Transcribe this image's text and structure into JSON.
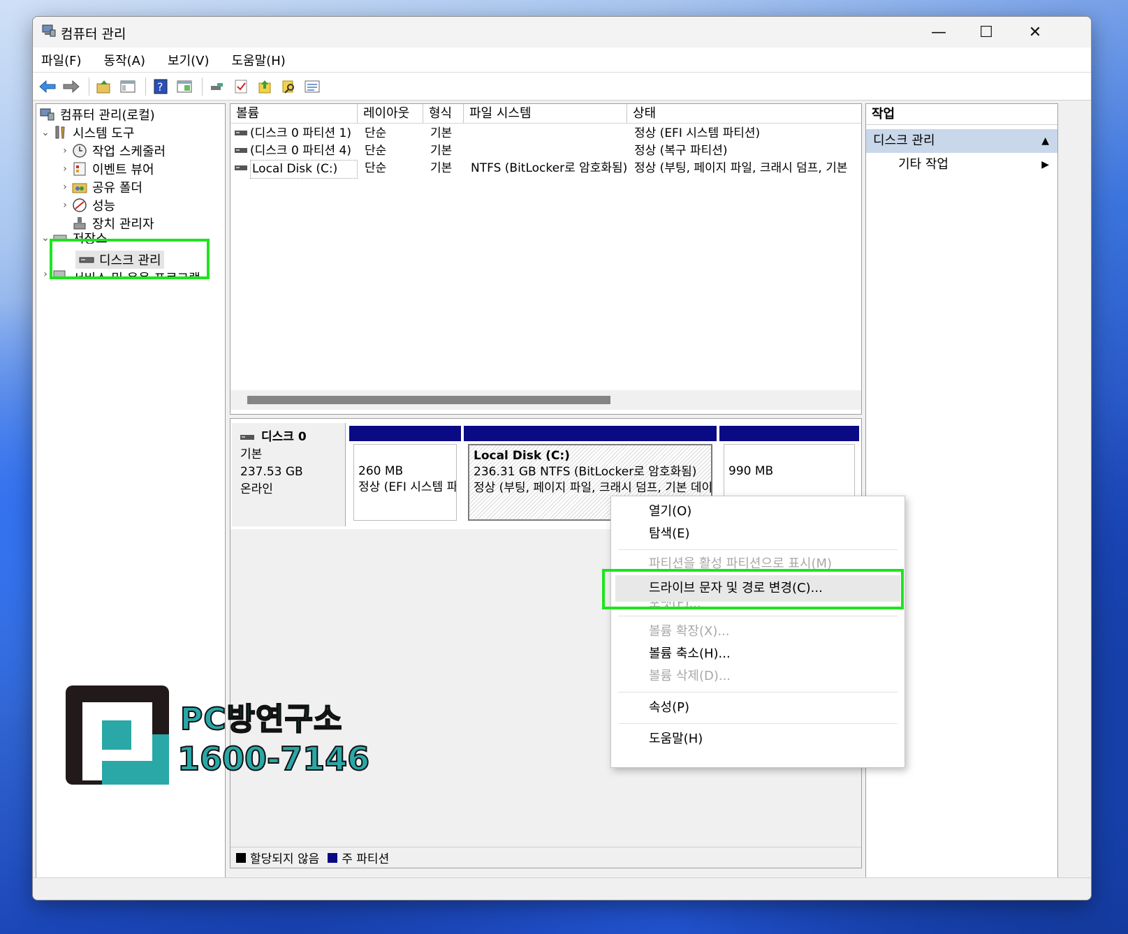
{
  "window": {
    "title": "컴퓨터 관리",
    "controls": {
      "minimize": "—",
      "maximize": "☐",
      "close": "✕"
    }
  },
  "menu": [
    "파일(F)",
    "동작(A)",
    "보기(V)",
    "도움말(H)"
  ],
  "toolbar": [
    "back-icon",
    "forward-icon",
    "up-folder-icon",
    "show-hide-tree-icon",
    "help-icon",
    "console-view-icon",
    "connect-icon",
    "check-icon",
    "export-icon",
    "search-icon",
    "properties-icon"
  ],
  "tree": {
    "root": "컴퓨터 관리(로컬)",
    "system_tools": "시스템 도구",
    "task_scheduler": "작업 스케줄러",
    "event_viewer": "이벤트 뷰어",
    "shared_folders": "공유 폴더",
    "performance": "성능",
    "device_manager": "장치 관리자",
    "storage": "저장소",
    "disk_management": "디스크 관리",
    "services": "서비스 및 응용 프로그램"
  },
  "volumes": {
    "columns": [
      "볼륨",
      "레이아웃",
      "형식",
      "파일 시스템",
      "상태"
    ],
    "rows": [
      {
        "volume": "(디스크 0 파티션 1)",
        "layout": "단순",
        "type": "기본",
        "fs": "",
        "status": "정상 (EFI 시스템 파티션)"
      },
      {
        "volume": "(디스크 0 파티션 4)",
        "layout": "단순",
        "type": "기본",
        "fs": "",
        "status": "정상 (복구 파티션)"
      },
      {
        "volume": "Local Disk (C:)",
        "layout": "단순",
        "type": "기본",
        "fs": "NTFS (BitLocker로 암호화됨)",
        "status": "정상 (부팅, 페이지 파일, 크래시 덤프, 기본"
      }
    ]
  },
  "disk": {
    "name": "디스크 0",
    "type": "기본",
    "size": "237.53 GB",
    "state": "온라인",
    "partitions": [
      {
        "title": "",
        "size": "260 MB",
        "desc": "정상 (EFI 시스템 파티션)"
      },
      {
        "title": "Local Disk  (C:)",
        "size": "236.31 GB NTFS (BitLocker로 암호화됨)",
        "desc": "정상 (부팅, 페이지 파일, 크래시 덤프, 기본 데이터 파티션)"
      },
      {
        "title": "",
        "size": "990 MB",
        "desc": ""
      }
    ]
  },
  "legend": {
    "unallocated": "할당되지 않음",
    "primary": "주 파티션",
    "unallocated_color": "#000000",
    "primary_color": "#0a0a85"
  },
  "actions": {
    "header": "작업",
    "section": "디스크 관리",
    "more": "기타 작업"
  },
  "context_menu": {
    "open": "열기(O)",
    "explore": "탐색(E)",
    "mark_active": "파티션을 활성 파티션으로 표시(M)",
    "change_letter": "드라이브 문자 및 경로 변경(C)...",
    "format": "포맷(F)...",
    "extend": "볼륨 확장(X)...",
    "shrink": "볼륨 축소(H)...",
    "delete": "볼륨 삭제(D)...",
    "properties": "속성(P)",
    "help": "도움말(H)"
  },
  "watermark": {
    "brand": "PC방연구소",
    "phone": "1600-7146"
  },
  "colors": {
    "highlight": "#1ee31e",
    "partition_bar": "#0a0a85",
    "watermark": "#2aa7a7"
  }
}
